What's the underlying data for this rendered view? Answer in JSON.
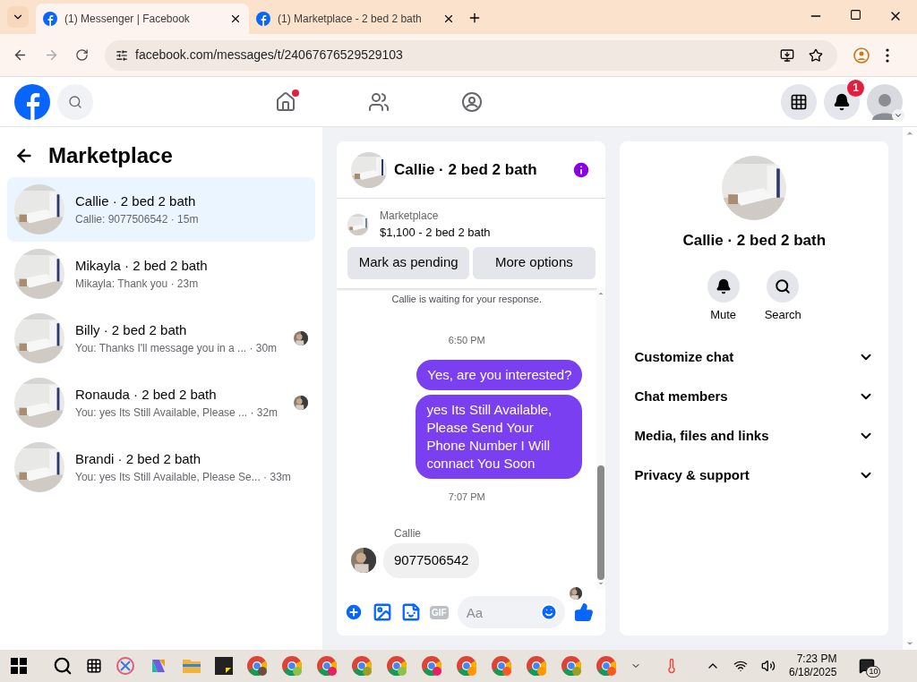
{
  "browser": {
    "tabs": [
      {
        "title": "(1) Messenger | Facebook",
        "selected": true
      },
      {
        "title": "(1) Marketplace - 2 bed 2 bath",
        "selected": false
      }
    ],
    "address": "facebook.com/messages/t/24067676529529103"
  },
  "header": {
    "notification_count": "1",
    "home_unread": true
  },
  "sidebar": {
    "title": "Marketplace",
    "conversations": [
      {
        "name": "Callie · 2 bed 2 bath",
        "preview": "Callie: 9077506542 · 15m",
        "selected": true,
        "read_receipt": false
      },
      {
        "name": "Mikayla · 2 bed 2 bath",
        "preview": "Mikayla: Thank you · 23m",
        "selected": false,
        "read_receipt": false
      },
      {
        "name": "Billy · 2 bed 2 bath",
        "preview": "You: Thanks I'll message you in a ... · 30m",
        "selected": false,
        "read_receipt": true
      },
      {
        "name": "Ronauda · 2 bed 2 bath",
        "preview": "You: yes Its Still Available, Please ...  · 32m",
        "selected": false,
        "read_receipt": true
      },
      {
        "name": "Brandi · 2 bed 2 bath",
        "preview": "You: yes Its Still Available, Please Se...  · 33m",
        "selected": false,
        "read_receipt": false
      }
    ]
  },
  "chat": {
    "title": "Callie · 2 bed 2 bath",
    "listing": {
      "source": "Marketplace",
      "title": "$1,100 - 2 bed 2 bath"
    },
    "buttons": [
      "Mark as pending",
      "More options"
    ],
    "notice": "Callie is waiting for your response.",
    "messages": [
      {
        "kind": "time",
        "text": "6:50 PM"
      },
      {
        "kind": "outgoing",
        "text": "Yes, are you interested?"
      },
      {
        "kind": "outgoing",
        "text": "yes Its Still Available, Please Send Your Phone Number I Will connact You Soon"
      },
      {
        "kind": "time",
        "text": "7:07 PM"
      },
      {
        "kind": "incoming",
        "sender": "Callie",
        "text": "9077506542"
      }
    ],
    "composer": {
      "placeholder": "Aa"
    },
    "gif_label": "GIF"
  },
  "info": {
    "name": "Callie · 2 bed 2 bath",
    "actions": [
      {
        "kind": "mute",
        "label": "Mute"
      },
      {
        "kind": "search",
        "label": "Search"
      }
    ],
    "sections": [
      "Customize chat",
      "Chat members",
      "Media, files and links",
      "Privacy & support"
    ]
  },
  "taskbar": {
    "time": "7:23 PM",
    "date": "6/18/2025",
    "notification_count": "10"
  }
}
